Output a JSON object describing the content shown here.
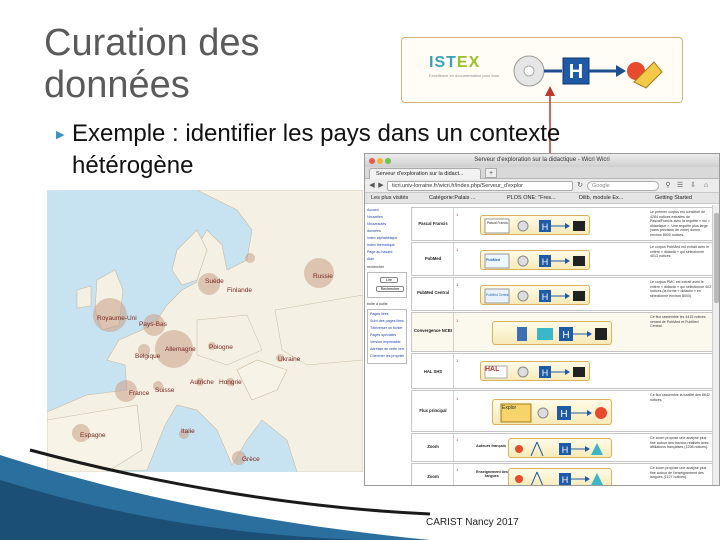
{
  "slide": {
    "title_line1": "Curation des",
    "title_line2": "données",
    "bullet_line1": "Exemple : identifier les pays dans un contexte",
    "bullet_line2": "hétérogène",
    "footer": "CARIST Nancy 2017"
  },
  "istex": {
    "logo_a": "IST",
    "logo_b": "EX",
    "subtitle": "Excellence en documentation pour tous"
  },
  "map": {
    "countries": [
      {
        "name": "Finlande"
      },
      {
        "name": "Russie"
      },
      {
        "name": "Suède"
      },
      {
        "name": "Royaume-Uni"
      },
      {
        "name": "Pays-Bas"
      },
      {
        "name": "Allemagne"
      },
      {
        "name": "Pologne"
      },
      {
        "name": "Belgique"
      },
      {
        "name": "Ukraine"
      },
      {
        "name": "Autriche"
      },
      {
        "name": "Hongrie"
      },
      {
        "name": "France"
      },
      {
        "name": "Suisse"
      },
      {
        "name": "Espagne"
      },
      {
        "name": "Italie"
      },
      {
        "name": "Grèce"
      }
    ]
  },
  "browser": {
    "window_title": "Serveur d'exploration sur la didactique - Wicri Wicri",
    "tab_label": "Serveur d'exploration sur la didact...",
    "tab_plus": "+",
    "url": "ticri.univ-lorraine.fr/wicri.fr/index.php/Serveur_d'explor",
    "search_placeholder": "Google",
    "bookmarks": [
      "Les plus visités",
      "Catégorie:Palais ...",
      "PLOS ONE: \"Fres...",
      "Dilib, module Ex...",
      "Getting Started"
    ],
    "leftnav": {
      "items_top": [
        "Accueil",
        "Nouvelles",
        "Nouveautés",
        "Page au hasard",
        "Aide"
      ],
      "items_doc": [
        "données",
        "Index alphabétique",
        "Index thématique",
        "Page au hasard",
        "Aide"
      ],
      "search_label": "rechercher",
      "read_button": "Lire",
      "search_button": "Rechercher",
      "tools_label": "boîte à outils",
      "tools": [
        "Pages liées",
        "Suivi des pages liées",
        "Téléverser un fichier",
        "Pages spéciales",
        "Version imprimable",
        "Adresse de cette version",
        "Chercher les propriétés"
      ]
    },
    "rows": [
      {
        "label": "Pascal Francis",
        "num": "1",
        "box": "Pascal Francis",
        "desc": "Le premier corpus est constitué de 4284 notices extraites de PascalFrancis avec la requête « mc = didactique ». Une requête plus large (sans précision de zone) donne environ 8000 notices."
      },
      {
        "label": "PubMed",
        "num": "1",
        "box": "PubMed",
        "desc": "Le corpus PubMed est extrait avec le critère « didactic » qui sélectionne 4013 notices."
      },
      {
        "label": "PubMed Central",
        "num": "1",
        "box": "PubMed Central",
        "desc": "Le corpus PMC est extrait avec le critère « didactic » qui sélectionne 402 notices (la forme « didactic » en sélectionne environ 8000)."
      },
      {
        "label": "Convergence NCBI",
        "num": "1",
        "box": "",
        "desc": "Ce flux rassemble les 4415 notices venant de PubMed et PubMed Central."
      },
      {
        "label": "HAL SHS",
        "num": "1",
        "box": "HAL",
        "desc": ""
      },
      {
        "label": "Flux principal",
        "num": "1",
        "box": "Explor",
        "desc": "Ce flux rassemble la totalité des 8642 notices."
      },
      {
        "label": "Zoom",
        "num": "1",
        "box": "Auteurs français",
        "desc": "Ce zoom propose une analyse plus fine autour des travaux réalisés avec affiliations françaises (1298 notices)."
      },
      {
        "label": "Zoom",
        "num": "1",
        "box": "Enseignement des langues",
        "desc": "Ce zoom propose une analyse plus fine autour de l'enseignement des langues (1127 notices)."
      }
    ]
  }
}
